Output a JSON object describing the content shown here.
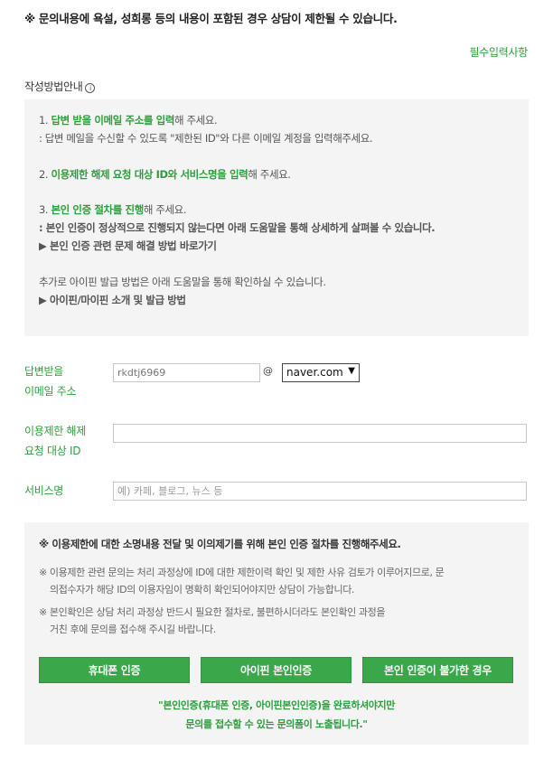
{
  "notice": "※ 문의내용에 욕설, 성희롱 등의 내용이 포함된 경우 상담이 제한될 수 있습니다.",
  "required_link": "필수입력사항",
  "guide": {
    "title": "작성방법안내",
    "info_icon": "ⓘ",
    "step1_prefix": "1. ",
    "step1_bold": "답변 받을 이메일 주소를 입력",
    "step1_suffix": "해 주세요.",
    "step1_note": ": 답변 메일을 수신할 수 있도록 \"제한된 ID\"와 다른 이메일 계정을 입력해주세요.",
    "step2_prefix": "2. ",
    "step2_bold": "이용제한 해제 요청 대상 ID와 서비스명을 입력",
    "step2_suffix": "해 주세요.",
    "step3_prefix": "3. ",
    "step3_bold": "본인 인증 절차를 진행",
    "step3_suffix": "해 주세요.",
    "step3_note": ": 본인 인증이 정상적으로 진행되지 않는다면 아래 도움말을 통해 상세하게 살펴볼 수 있습니다.",
    "step3_link": "▶ 본인 인증 관련 문제 해결 방법 바로가기",
    "ipin_text": "추가로 아이핀 발급 방법은 아래 도움말을 통해 확인하실 수 있습니다.",
    "ipin_link": "▶ 아이핀/마이핀 소개 및 발급 방법"
  },
  "form": {
    "email_label_1": "답변받을",
    "email_label_2": "이메일 주소",
    "email_value": "rkdtj6969",
    "at": "@",
    "domain_value": "naver.com",
    "domain_arrow": "▼",
    "target_id_label_1": "이용제한 해제",
    "target_id_label_2": "요청 대상 ID",
    "target_id_value": "",
    "service_label": "서비스명",
    "service_placeholder": "예) 카페, 블로그, 뉴스 등"
  },
  "auth": {
    "header": "※ 이용제한에 대한 소명내용 전달 및 이의제기를 위해 본인 인증 절차를 진행해주세요.",
    "note1_line1": "※ 이용제한 관련 문의는 처리 과정상에 ID에 대한 제한이력 확인 및 제한 사유 검토가 이루어지므로, 문",
    "note1_line2": "의접수자가 해당 ID의 이용자임이 명확히 확인되어야지만 상담이 가능합니다.",
    "note2_line1": "※ 본인확인은 상담 처리 과정상 반드시 필요한 절차로, 불편하시더라도 본인확인 과정을",
    "note2_line2": "거친 후에 문의를 접수해 주시길 바랍니다.",
    "btn_phone": "휴대폰 인증",
    "btn_ipin": "아이핀 본인인증",
    "btn_unavailable": "본인 인증이 불가한 경우",
    "footer_line1": "\"본인인증(휴대폰 인증, 아이핀본인인증)을 완료하셔야지만",
    "footer_line2": "문의를 접수할 수 있는 문의폼이 노출됩니다.\""
  }
}
